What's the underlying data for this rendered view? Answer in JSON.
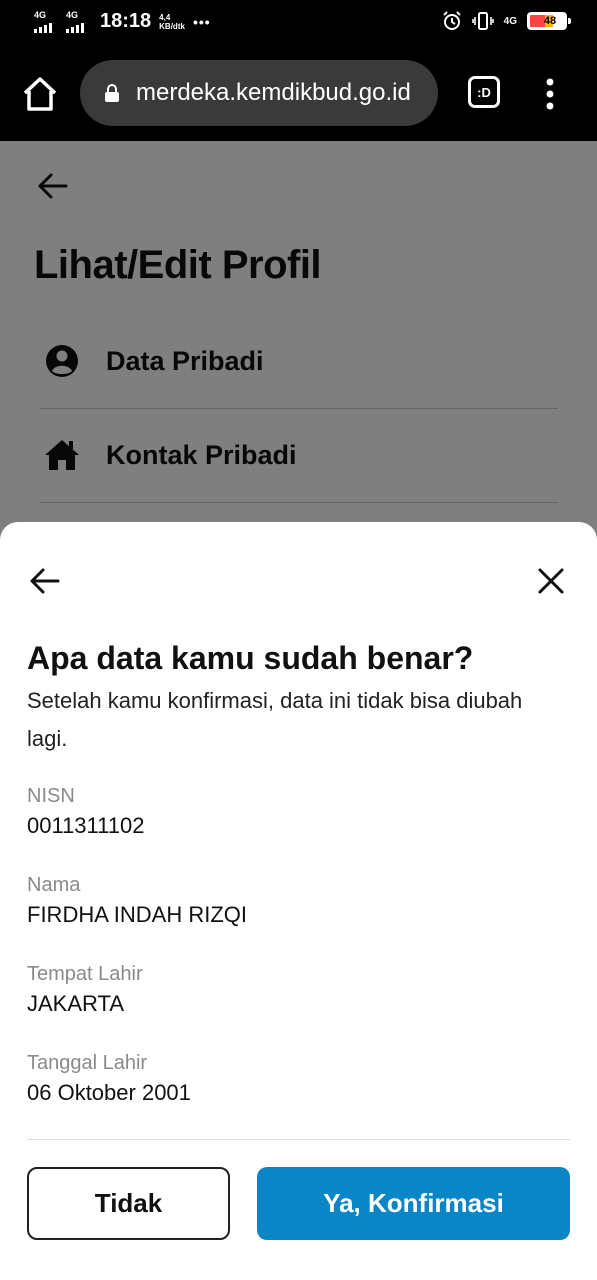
{
  "status_bar": {
    "network1_label": "4G",
    "network2_label": "4G",
    "time": "18:18",
    "speed_value": "4,4",
    "speed_unit": "KB/dtk",
    "more": "•••",
    "lte_label": "4G",
    "battery": "48"
  },
  "browser": {
    "url": "merdeka.kemdikbud.go.id",
    "tabs_label": ":D"
  },
  "page": {
    "title": "Lihat/Edit Profil",
    "menu": [
      {
        "label": "Data Pribadi",
        "icon": "user-circle-icon"
      },
      {
        "label": "Kontak Pribadi",
        "icon": "home-icon"
      }
    ]
  },
  "dialog": {
    "title": "Apa data kamu sudah benar?",
    "description": "Setelah kamu konfirmasi, data ini tidak bisa diubah lagi.",
    "fields": [
      {
        "label": "NISN",
        "value": "0011311102"
      },
      {
        "label": "Nama",
        "value": "FIRDHA INDAH RIZQI"
      },
      {
        "label": "Tempat Lahir",
        "value": "JAKARTA"
      },
      {
        "label": "Tanggal Lahir",
        "value": "06 Oktober 2001"
      }
    ],
    "cancel_label": "Tidak",
    "confirm_label": "Ya, Konfirmasi"
  },
  "colors": {
    "primary": "#0a86c7",
    "overlay": "rgba(0,0,0,0.5)"
  }
}
